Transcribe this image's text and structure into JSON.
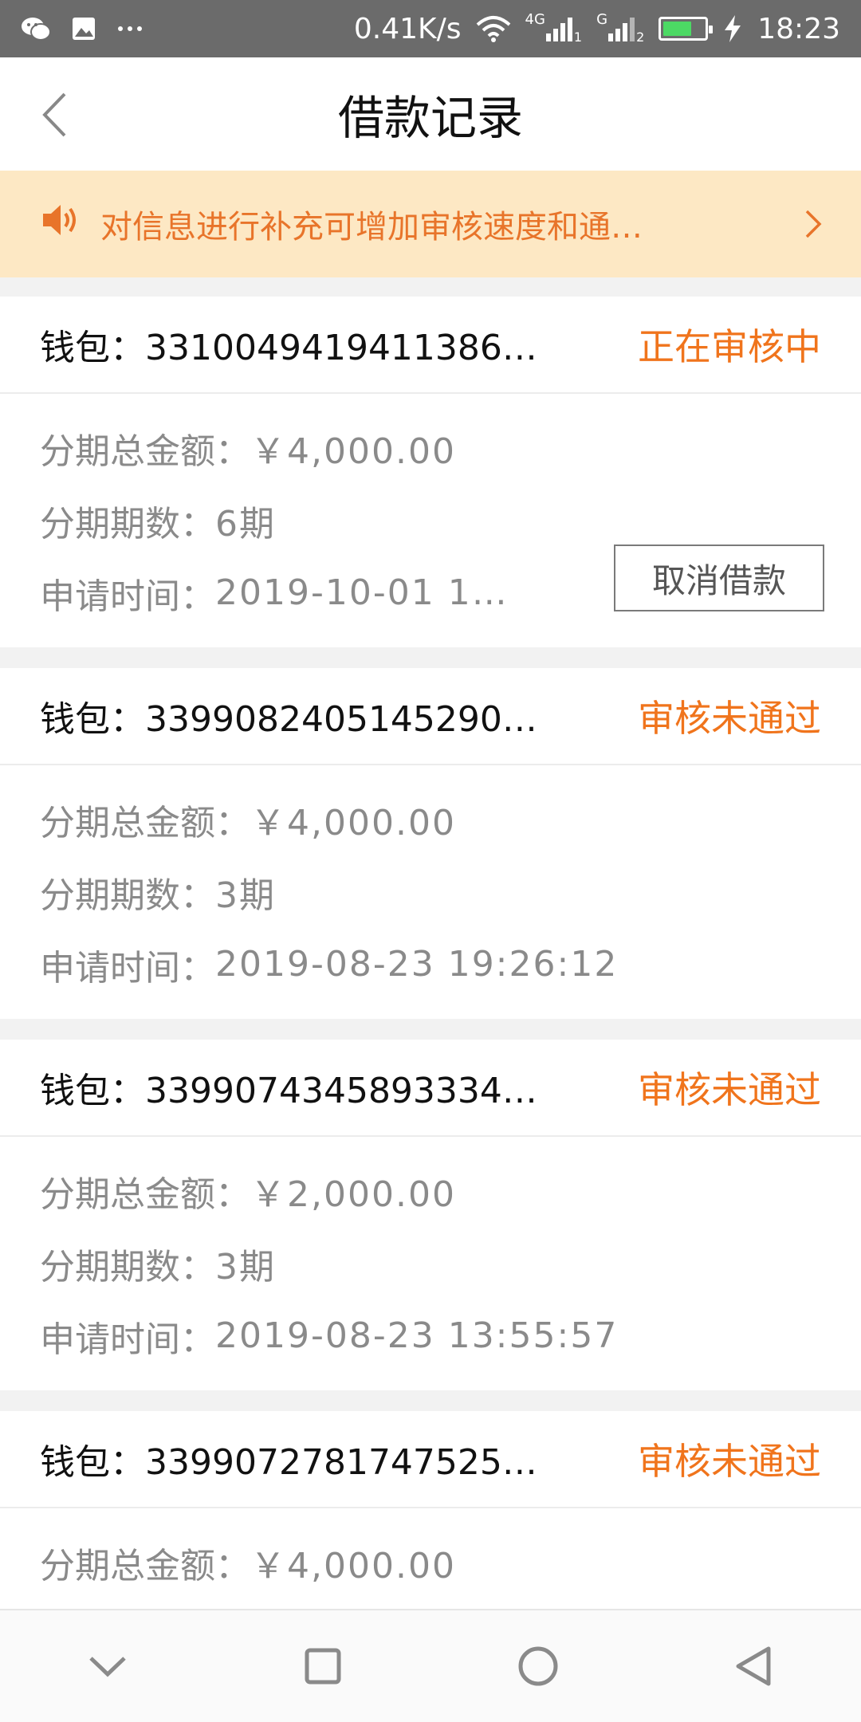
{
  "status_bar": {
    "net_speed": "0.41K/s",
    "sim1_type": "4G",
    "sim1_index": "1",
    "sim2_type": "G",
    "sim2_index": "2",
    "time": "18:23",
    "battery_level": 0.7,
    "icons": [
      "wechat-icon",
      "gallery-icon",
      "more-icon",
      "wifi-icon",
      "signal-icon",
      "battery-icon",
      "charging-icon"
    ]
  },
  "header": {
    "title": "借款记录"
  },
  "notice": {
    "text": "对信息进行补充可增加审核速度和通…"
  },
  "labels": {
    "total": "分期总金额：",
    "periods": "分期期数：",
    "apply_time": "申请时间：",
    "cancel": "取消借款"
  },
  "records": [
    {
      "wallet": "钱包：3310049419411386…",
      "status": "正在审核中",
      "amount": "￥4,000.00",
      "periods": "6期",
      "time": "2019-10-01 1…"
    },
    {
      "wallet": "钱包：3399082405145290…",
      "status": "审核未通过",
      "amount": "￥4,000.00",
      "periods": "3期",
      "time": "2019-08-23 19:26:12"
    },
    {
      "wallet": "钱包：3399074345893334…",
      "status": "审核未通过",
      "amount": "￥2,000.00",
      "periods": "3期",
      "time": "2019-08-23 13:55:57"
    },
    {
      "wallet": "钱包：3399072781747525…",
      "status": "审核未通过",
      "amount": "￥4,000.00"
    }
  ],
  "colors": {
    "accent": "#f0741c",
    "banner_bg": "#fde8c4",
    "status_bar_bg": "#6b6b6b"
  }
}
